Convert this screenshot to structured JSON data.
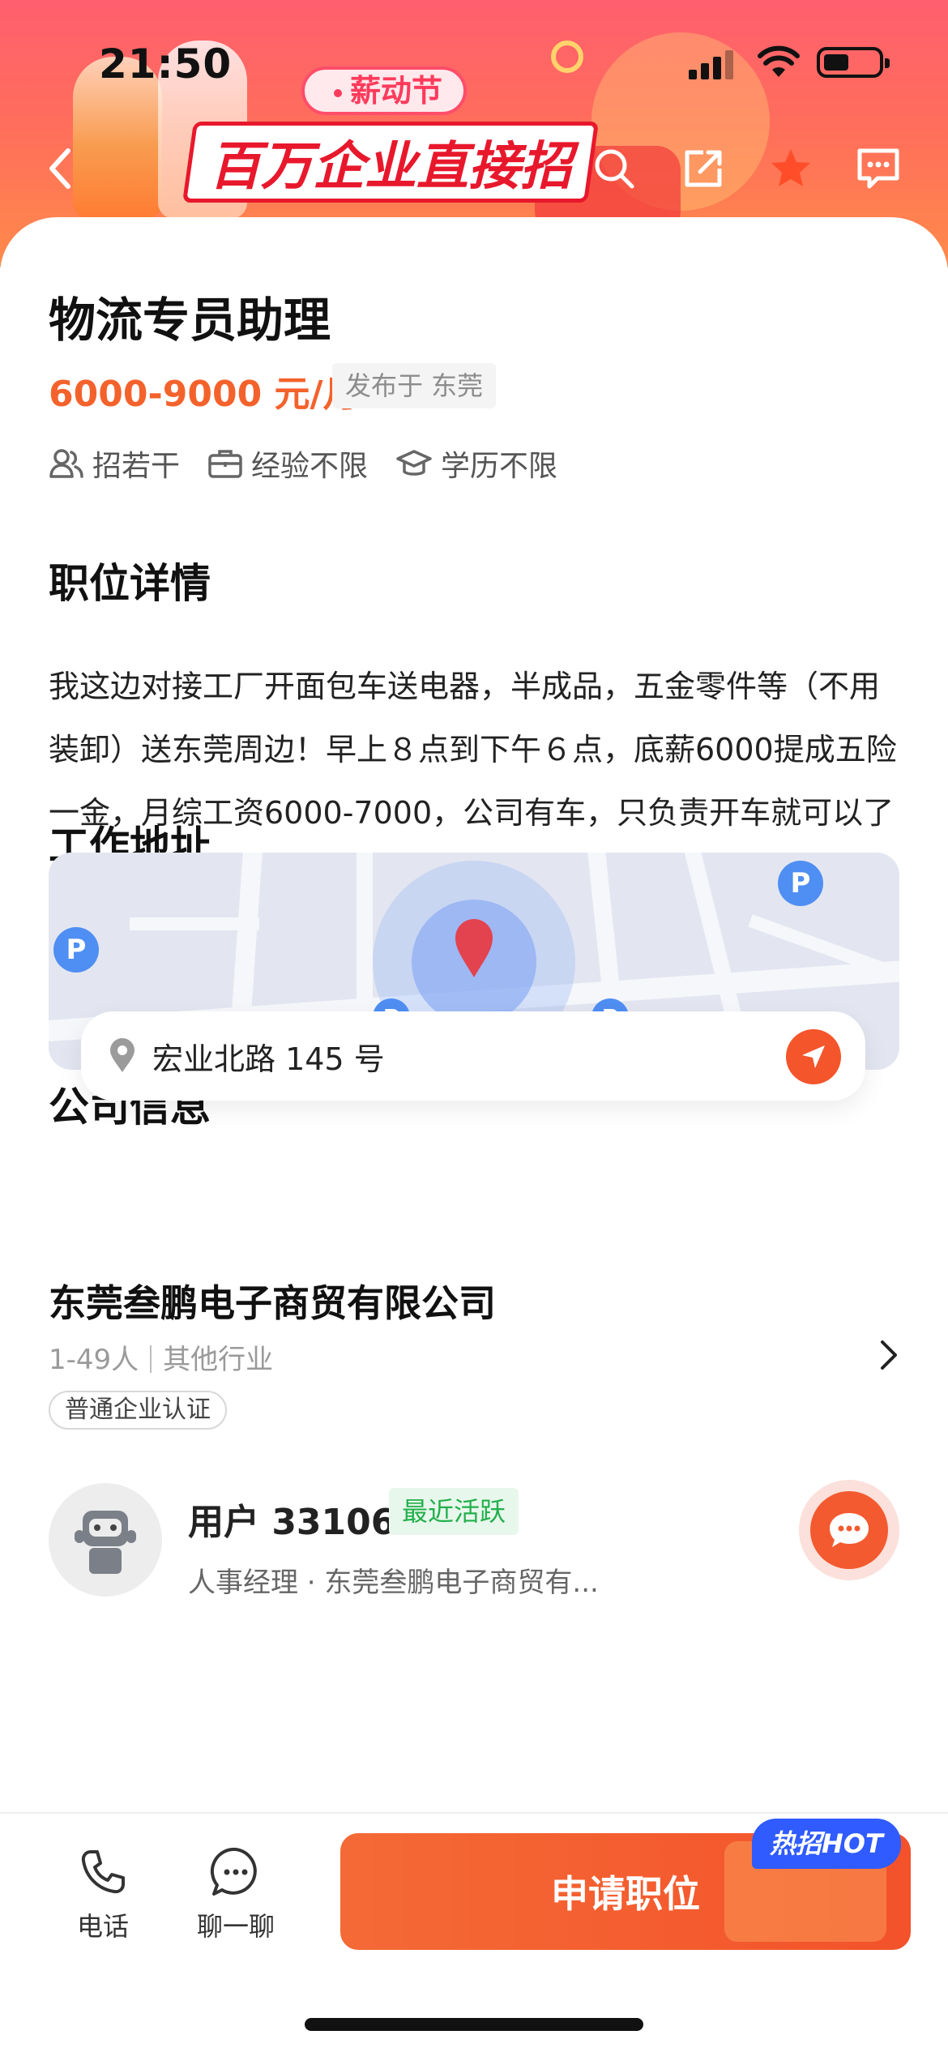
{
  "status_bar": {
    "time": "21:50"
  },
  "banner": {
    "festival_tag": "薪动节",
    "title": "百万企业直接招"
  },
  "job": {
    "title": "物流专员助理",
    "salary": "6000-9000 元/月",
    "publish_location": "发布于 东莞",
    "tags": [
      {
        "icon": "people-icon",
        "label": "招若干"
      },
      {
        "icon": "briefcase-icon",
        "label": "经验不限"
      },
      {
        "icon": "graduation-cap-icon",
        "label": "学历不限"
      }
    ]
  },
  "details": {
    "heading": "职位详情",
    "description": "我这边对接工厂开面包车送电器，半成品，五金零件等（不用装卸）送东莞周边！早上８点到下午６点，底薪6000提成五险一金，月综工资6000-7000，公司有车，只负责开车就可以了"
  },
  "address": {
    "heading": "工作地址",
    "text": "宏业北路 145 号"
  },
  "company": {
    "heading": "公司信息",
    "name": "东莞叁鹏电子商贸有限公司",
    "size": "1-49人",
    "industry": "其他行业",
    "verification": "普通企业认证"
  },
  "recruiter": {
    "name": "用户 33106",
    "status": "最近活跃",
    "role": "人事经理 · 东莞叁鹏电子商贸有..."
  },
  "bottom_bar": {
    "phone_label": "电话",
    "chat_label": "聊一聊",
    "apply_label": "申请职位",
    "hot_badge": "热招HOT"
  },
  "colors": {
    "accent": "#f4622c",
    "banner": "#ff6d5c",
    "active_green": "#22b04b",
    "hot_blue": "#2f5bff"
  }
}
